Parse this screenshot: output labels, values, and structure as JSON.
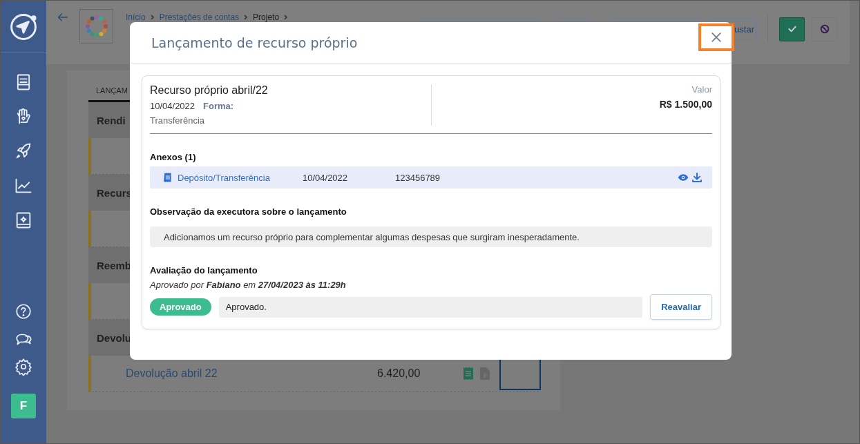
{
  "sidebar": {
    "avatar": "F"
  },
  "header": {
    "breadcrumb": [
      {
        "label": "Início",
        "link": true
      },
      {
        "label": "Prestações de contas",
        "link": true
      },
      {
        "label": "Projeto",
        "link": false
      }
    ],
    "partial_button": "ustar"
  },
  "tab_label": "LANÇAM",
  "groups": [
    {
      "title": "Rendi",
      "rows": [
        {}
      ]
    },
    {
      "title": "Recurs",
      "rows": [
        {}
      ]
    },
    {
      "title": "Reemb",
      "rows": [
        {}
      ]
    },
    {
      "title": "Devolu",
      "rows": [
        {
          "name": "Devolução abril 22",
          "amount": "6.420,00"
        }
      ]
    }
  ],
  "modal": {
    "title": "Lançamento de recurso próprio",
    "entry": {
      "name": "Recurso próprio abril/22",
      "date": "10/04/2022",
      "form_label": "Forma:",
      "form_value": "Transferência",
      "value_label": "Valor",
      "value": "R$ 1.500,00"
    },
    "attachments_title": "Anexos (1)",
    "attachments": [
      {
        "name": "Depósito/Transferência",
        "date": "10/04/2022",
        "number": "123456789"
      }
    ],
    "note_title": "Observação da executora sobre o lançamento",
    "note": "Adicionamos um recurso próprio para complementar algumas despesas que surgiram inesperadamente.",
    "review_title": "Avaliação do lançamento",
    "review_info": "Aprovado por **Fabiano** em **27/04/2023 às 11:29h**",
    "status": {
      "label": "Aprovado",
      "kind": "approved"
    },
    "review_comment": "Aprovado.",
    "reevaluate_button": "Reavaliar"
  }
}
